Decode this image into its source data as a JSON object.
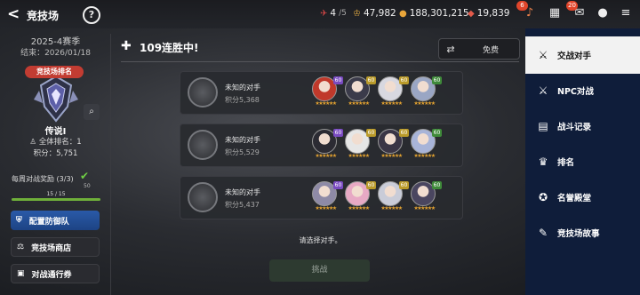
{
  "header": {
    "title": "竞技场",
    "resources": [
      {
        "icon": "ticket-icon",
        "value": "4",
        "sub": "/5"
      },
      {
        "icon": "gold-icon",
        "value": "47,982",
        "sub": ""
      },
      {
        "icon": "coin-icon",
        "value": "188,301,215",
        "sub": ""
      },
      {
        "icon": "gem-icon",
        "value": "19,839",
        "sub": ""
      }
    ],
    "badges": {
      "bell": "6",
      "mail": "20"
    }
  },
  "left": {
    "season": "2025-4赛季",
    "end_date": "结束：2026/01/18",
    "ranking_banner": "竞技场排名",
    "tier": "传说I",
    "rank": "全体排名：1",
    "points": "积分：5,751",
    "weekly_reward": "每周对战奖励 (3/3)",
    "check_sub": "50",
    "progress_text": "15 / 15",
    "progress": 1.0,
    "buttons": [
      "配置防御队",
      "竞技场商店",
      "对战通行券"
    ]
  },
  "main": {
    "streak": "109连胜中!",
    "free_label": "免费",
    "prompt": "请选择对手。",
    "fight_label": "挑战"
  },
  "opponents": [
    {
      "name": "未知的对手",
      "points": "积分5,368",
      "heroes": [
        {
          "lv": "60",
          "lv_color": "#7a4bc2",
          "c": "#c0392b"
        },
        {
          "lv": "60",
          "lv_color": "#b99a2a",
          "c": "#3b3b4a"
        },
        {
          "lv": "60",
          "lv_color": "#b99a2a",
          "c": "#d8d8e0"
        },
        {
          "lv": "60",
          "lv_color": "#3f8a3a",
          "c": "#9aa6c4"
        }
      ]
    },
    {
      "name": "未知的对手",
      "points": "积分5,529",
      "heroes": [
        {
          "lv": "60",
          "lv_color": "#7a4bc2",
          "c": "#2b2b33"
        },
        {
          "lv": "60",
          "lv_color": "#b99a2a",
          "c": "#e6e6e6"
        },
        {
          "lv": "60",
          "lv_color": "#b99a2a",
          "c": "#3a3545"
        },
        {
          "lv": "60",
          "lv_color": "#3f8a3a",
          "c": "#a8b4d8"
        }
      ]
    },
    {
      "name": "未知的对手",
      "points": "积分5,437",
      "heroes": [
        {
          "lv": "60",
          "lv_color": "#7a4bc2",
          "c": "#8e8aa6"
        },
        {
          "lv": "60",
          "lv_color": "#b99a2a",
          "c": "#e7a9c4"
        },
        {
          "lv": "60",
          "lv_color": "#b99a2a",
          "c": "#c9ccd8"
        },
        {
          "lv": "60",
          "lv_color": "#3f8a3a",
          "c": "#4a4660"
        }
      ]
    }
  ],
  "menu": [
    {
      "label": "交战对手",
      "icon": "crossed-swords-icon",
      "glyph": "⚔",
      "active": true
    },
    {
      "label": "NPC对战",
      "icon": "npc-swords-icon",
      "glyph": "⚔",
      "active": false
    },
    {
      "label": "战斗记录",
      "icon": "clipboard-icon",
      "glyph": "▤",
      "active": false
    },
    {
      "label": "排名",
      "icon": "trophy-icon",
      "glyph": "♛",
      "active": false
    },
    {
      "label": "名誉殿堂",
      "icon": "laurel-icon",
      "glyph": "✪",
      "active": false
    },
    {
      "label": "竞技场故事",
      "icon": "book-icon",
      "glyph": "✎",
      "active": false
    }
  ]
}
